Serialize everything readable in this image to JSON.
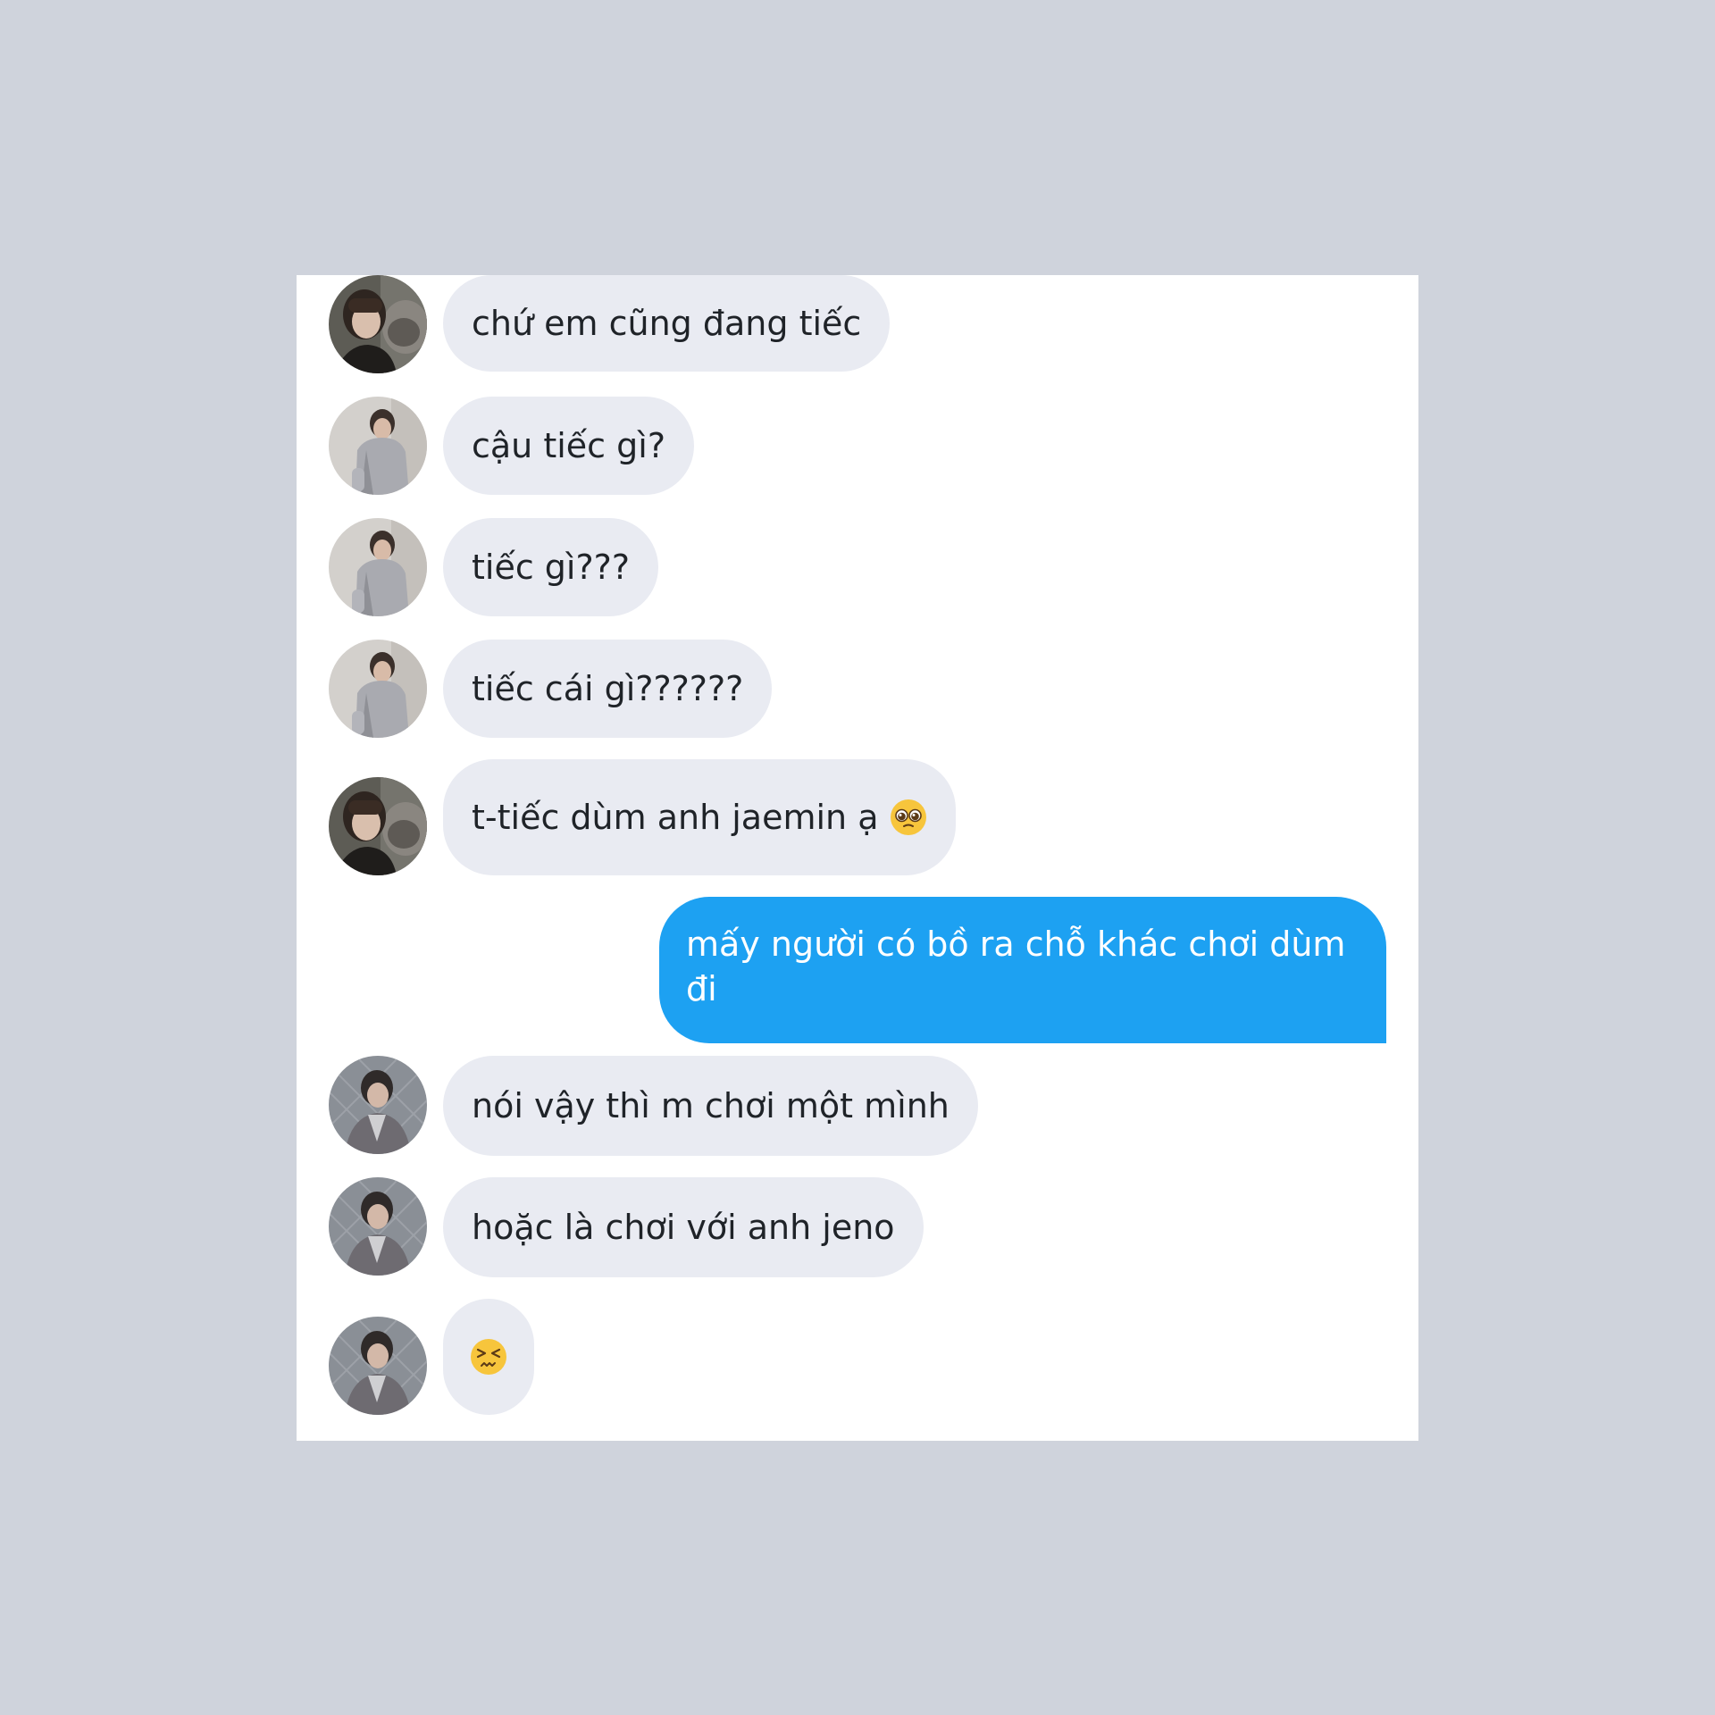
{
  "messages": [
    {
      "id": "m1",
      "direction": "incoming",
      "sender_avatar": "avatar-a",
      "text": "chứ em cũng đang tiếc"
    },
    {
      "id": "m2",
      "direction": "incoming",
      "sender_avatar": "avatar-b",
      "text": "cậu tiếc gì?"
    },
    {
      "id": "m3",
      "direction": "incoming",
      "sender_avatar": "avatar-b",
      "text": "tiếc gì???"
    },
    {
      "id": "m4",
      "direction": "incoming",
      "sender_avatar": "avatar-b",
      "text": "tiếc cái gì??????"
    },
    {
      "id": "m5",
      "direction": "incoming",
      "sender_avatar": "avatar-a",
      "text": "t-tiếc dùm anh jaemin ạ",
      "emoji": "pleading-face-icon"
    },
    {
      "id": "m6",
      "direction": "outgoing",
      "text": "mấy người có bồ ra chỗ khác chơi dùm đi"
    },
    {
      "id": "m7",
      "direction": "incoming",
      "sender_avatar": "avatar-c",
      "text": "nói vậy thì m chơi một mình"
    },
    {
      "id": "m8",
      "direction": "incoming",
      "sender_avatar": "avatar-c",
      "text": "hoặc là chơi với anh jeno"
    },
    {
      "id": "m9",
      "direction": "incoming",
      "sender_avatar": "avatar-c",
      "text": "",
      "emoji": "persevering-face-icon"
    }
  ],
  "colors": {
    "background": "#cfd3dc",
    "panel": "#ffffff",
    "incoming_bubble": "#e9ebf2",
    "outgoing_bubble": "#1da1f2",
    "incoming_text": "#1f2328",
    "outgoing_text": "#ffffff"
  }
}
